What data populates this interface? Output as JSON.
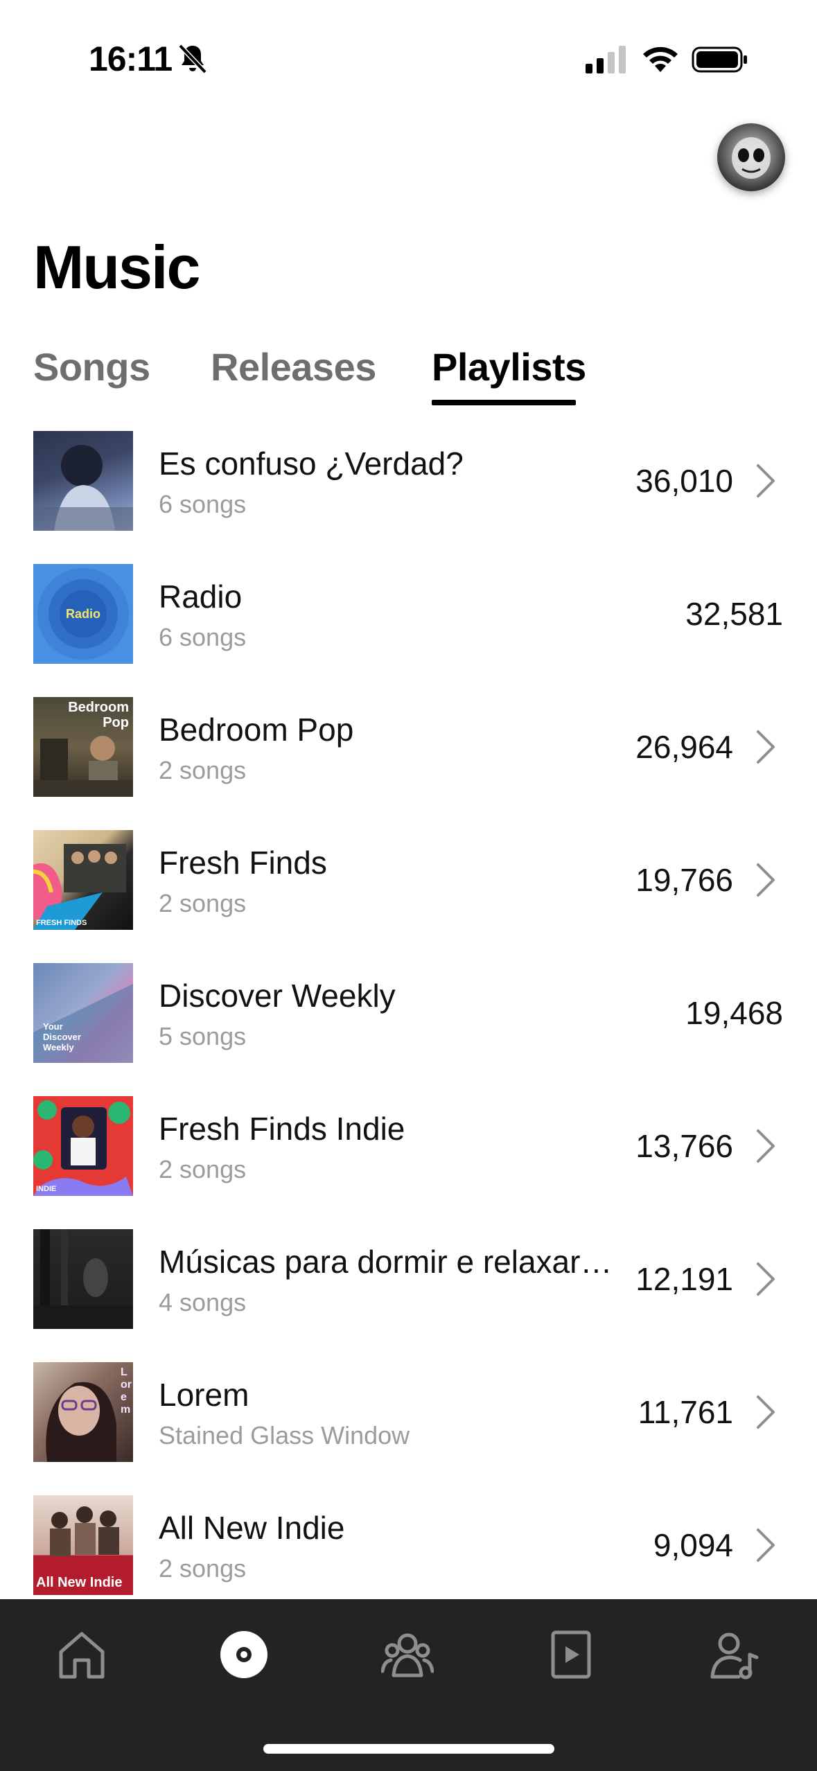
{
  "status_bar": {
    "time": "16:11",
    "icons": [
      "bell-slash-icon",
      "signal-icon",
      "wifi-icon",
      "battery-icon"
    ]
  },
  "header": {
    "title": "Music",
    "avatar_icon": "avatar"
  },
  "tabs": [
    {
      "label": "Songs",
      "active": false
    },
    {
      "label": "Releases",
      "active": false
    },
    {
      "label": "Playlists",
      "active": true
    }
  ],
  "playlists": [
    {
      "title": "Es confuso ¿Verdad?",
      "subtitle": "6 songs",
      "count": "36,010",
      "chevron": true
    },
    {
      "title": "Radio",
      "subtitle": "6 songs",
      "count": "32,581",
      "chevron": false,
      "cover_label": "Radio"
    },
    {
      "title": "Bedroom Pop",
      "subtitle": "2 songs",
      "count": "26,964",
      "chevron": true,
      "cover_label": "Bedroom Pop"
    },
    {
      "title": "Fresh Finds",
      "subtitle": "2 songs",
      "count": "19,766",
      "chevron": true,
      "cover_label": "FRESH FINDS"
    },
    {
      "title": "Discover Weekly",
      "subtitle": "5 songs",
      "count": "19,468",
      "chevron": false,
      "cover_label": "Your Discover Weekly"
    },
    {
      "title": "Fresh Finds Indie",
      "subtitle": "2 songs",
      "count": "13,766",
      "chevron": true,
      "cover_label": "INDIE"
    },
    {
      "title": "Músicas para dormir e relaxar…",
      "subtitle": "4 songs",
      "count": "12,191",
      "chevron": true
    },
    {
      "title": "Lorem",
      "subtitle": "Stained Glass Window",
      "count": "11,761",
      "chevron": true,
      "cover_label": "Lorem"
    },
    {
      "title": "All New Indie",
      "subtitle": "2 songs",
      "count": "9,094",
      "chevron": true,
      "cover_label": "All New Indie"
    }
  ],
  "bottom_nav": [
    {
      "name": "home-icon",
      "active": false
    },
    {
      "name": "music-disc-icon",
      "active": true
    },
    {
      "name": "friends-icon",
      "active": false
    },
    {
      "name": "video-icon",
      "active": false
    },
    {
      "name": "artist-icon",
      "active": false
    }
  ],
  "colors": {
    "active_text": "#000000",
    "inactive_tab": "#6e6e6e",
    "subtitle": "#9b9b9b",
    "nav_bg": "#232323",
    "nav_icon_inactive": "#8e8e8e",
    "nav_icon_active": "#ffffff"
  }
}
